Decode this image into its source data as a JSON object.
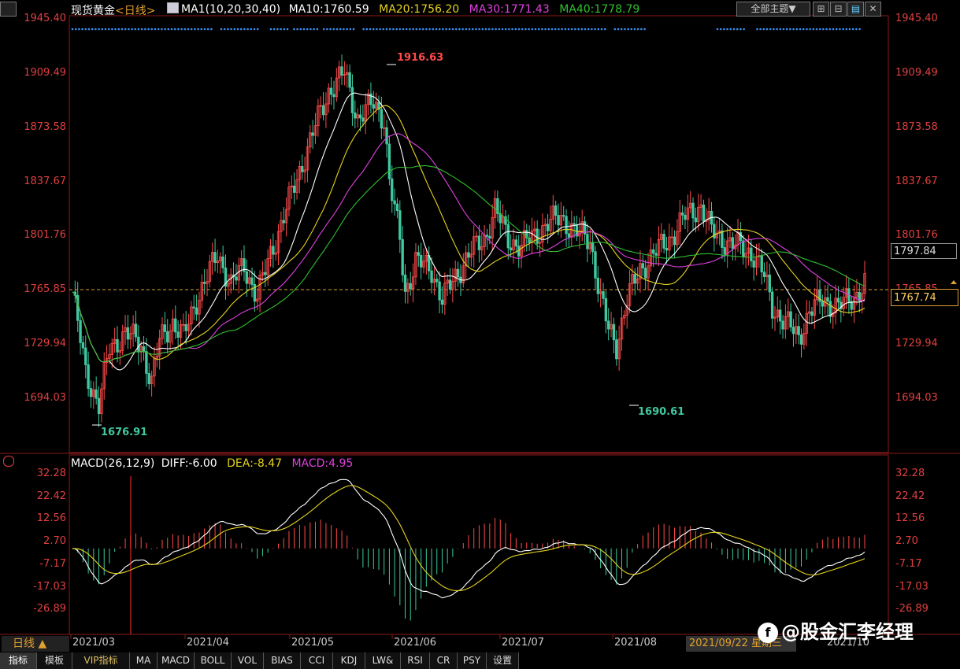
{
  "header": {
    "title": "现货黄金",
    "period": "<日线>",
    "ma_label": "MA1(10,20,30,40)",
    "ma10": "MA10:1760.59",
    "ma20": "MA20:1756.20",
    "ma30": "MA30:1771.43",
    "ma40": "MA40:1778.79",
    "theme_btn": "全部主题▼"
  },
  "price_axis": {
    "ticks": [
      "1945.40",
      "1909.49",
      "1873.58",
      "1837.67",
      "1801.76",
      "1765.85",
      "1729.94",
      "1694.03"
    ],
    "last_price_box": "1767.74",
    "ma_box": "1797.84"
  },
  "annotations": {
    "high": "1916.63",
    "low1": "1676.91",
    "low2": "1690.61"
  },
  "macd": {
    "label": "MACD(26,12,9)",
    "diff": "DIFF:-6.00",
    "dea": "DEA:-8.47",
    "macd": "MACD:4.95",
    "ticks": [
      "32.28",
      "22.42",
      "12.56",
      "2.70",
      "-7.17",
      "-17.03",
      "-26.89"
    ]
  },
  "date_axis": {
    "cursor_label": "日线 ▲",
    "months": [
      "2021/03",
      "2021/04",
      "2021/05",
      "2021/06",
      "2021/07",
      "2021/08",
      "2021/10"
    ],
    "cursor_date": "2021/09/22 星期三"
  },
  "watermark": "@股金汇李经理",
  "tabs": [
    "指标",
    "模板",
    "VIP指标",
    "MA",
    "MACD",
    "BOLL",
    "VOL",
    "BIAS",
    "CCI",
    "KDJ",
    "LW&",
    "RSI",
    "CR",
    "PSY",
    "设置"
  ],
  "colors": {
    "up": "#ff4a4a",
    "down": "#40c8a0",
    "ma10": "#ffffff",
    "ma20": "#e6d21e",
    "ma30": "#e040e0",
    "ma40": "#30c030",
    "axis_text": "#e04040"
  },
  "chart_data": {
    "type": "candlestick",
    "price_range": [
      1676.91,
      1945.4
    ],
    "macd_range": [
      -26.89,
      32.28
    ]
  }
}
